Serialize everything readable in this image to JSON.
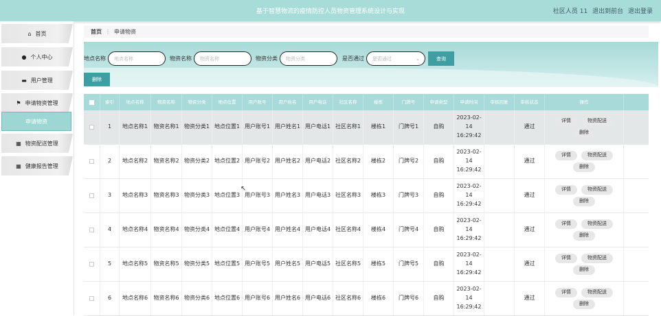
{
  "header": {
    "title": "基于智慧物流的疫情防控人员物资管理系统设计与实现",
    "user_label": "社区人员 11",
    "back_link": "退出到前台",
    "logout_link": "退出登录"
  },
  "sidebar": {
    "items": [
      {
        "label": "首页",
        "icon": "home-icon",
        "glyph": "⌂"
      },
      {
        "label": "个人中心",
        "icon": "person-icon",
        "glyph": "●"
      },
      {
        "label": "用户管理",
        "icon": "user-manage-icon",
        "glyph": "▬"
      },
      {
        "label": "申请物资管理",
        "icon": "flag-icon",
        "glyph": "⚑"
      },
      {
        "label": "申请物资",
        "icon": "",
        "glyph": ""
      },
      {
        "label": "物资配送管理",
        "icon": "grid-icon",
        "glyph": "▦"
      },
      {
        "label": "健康报告管理",
        "icon": "grid-icon",
        "glyph": "▦"
      }
    ]
  },
  "breadcrumb": {
    "home": "首页",
    "sep": "⋮",
    "current": "申请物资"
  },
  "search": {
    "f1_label": "地点名称",
    "f1_placeholder": "地点名称",
    "f2_label": "物资名称",
    "f2_placeholder": "物资名称",
    "f3_label": "物资分类",
    "f3_placeholder": "物资分类",
    "f4_label": "是否通过",
    "f4_placeholder": "是否通过",
    "query_button": "查询",
    "delete_button": "删除"
  },
  "table": {
    "headers": [
      "索引",
      "地点名称",
      "物资名称",
      "物资分类",
      "地点位置",
      "用户账号",
      "用户姓名",
      "用户电话",
      "社区名称",
      "楼栋",
      "门牌号",
      "申请类型",
      "申请时间",
      "审核回复",
      "审核状态",
      "操作"
    ],
    "actions": {
      "detail": "详情",
      "deliver": "物资配送",
      "delete": "删除"
    },
    "rows": [
      {
        "idx": "1",
        "place": "地点名称1",
        "mname": "物资名称1",
        "mcat": "物资分类1",
        "loc": "地点位置1",
        "acct": "用户账号1",
        "uname": "用户姓名1",
        "phone": "用户电话1",
        "comm": "社区名称1",
        "bldg": "楼栋1",
        "door": "门牌号1",
        "type": "自购",
        "time": "2023-02-14 16:29:42",
        "reply": "",
        "status": "通过"
      },
      {
        "idx": "2",
        "place": "地点名称2",
        "mname": "物资名称2",
        "mcat": "物资分类2",
        "loc": "地点位置2",
        "acct": "用户账号2",
        "uname": "用户姓名2",
        "phone": "用户电话2",
        "comm": "社区名称2",
        "bldg": "楼栋2",
        "door": "门牌号2",
        "type": "自购",
        "time": "2023-02-14 16:29:42",
        "reply": "",
        "status": "通过"
      },
      {
        "idx": "3",
        "place": "地点名称3",
        "mname": "物资名称3",
        "mcat": "物资分类3",
        "loc": "地点位置3",
        "acct": "用户账号3",
        "uname": "用户姓名3",
        "phone": "用户电话3",
        "comm": "社区名称3",
        "bldg": "楼栋3",
        "door": "门牌号3",
        "type": "自购",
        "time": "2023-02-14 16:29:42",
        "reply": "",
        "status": "通过"
      },
      {
        "idx": "4",
        "place": "地点名称4",
        "mname": "物资名称4",
        "mcat": "物资分类4",
        "loc": "地点位置4",
        "acct": "用户账号4",
        "uname": "用户姓名4",
        "phone": "用户电话4",
        "comm": "社区名称4",
        "bldg": "楼栋4",
        "door": "门牌号4",
        "type": "自购",
        "time": "2023-02-14 16:29:42",
        "reply": "",
        "status": "通过"
      },
      {
        "idx": "5",
        "place": "地点名称5",
        "mname": "物资名称5",
        "mcat": "物资分类5",
        "loc": "地点位置5",
        "acct": "用户账号5",
        "uname": "用户姓名5",
        "phone": "用户电话5",
        "comm": "社区名称5",
        "bldg": "楼栋5",
        "door": "门牌号5",
        "type": "自购",
        "time": "2023-02-14 16:29:42",
        "reply": "",
        "status": "通过"
      },
      {
        "idx": "6",
        "place": "地点名称6",
        "mname": "物资名称6",
        "mcat": "物资分类6",
        "loc": "地点位置6",
        "acct": "用户账号6",
        "uname": "用户姓名6",
        "phone": "用户电话6",
        "comm": "社区名称6",
        "bldg": "楼栋6",
        "door": "门牌号6",
        "type": "自购",
        "time": "2023-02-14 16:29:42",
        "reply": "",
        "status": "通过"
      }
    ]
  },
  "colors": {
    "accent": "#a7dad8",
    "button": "#3f9ea4",
    "active_menu": "#9cd7d3"
  }
}
